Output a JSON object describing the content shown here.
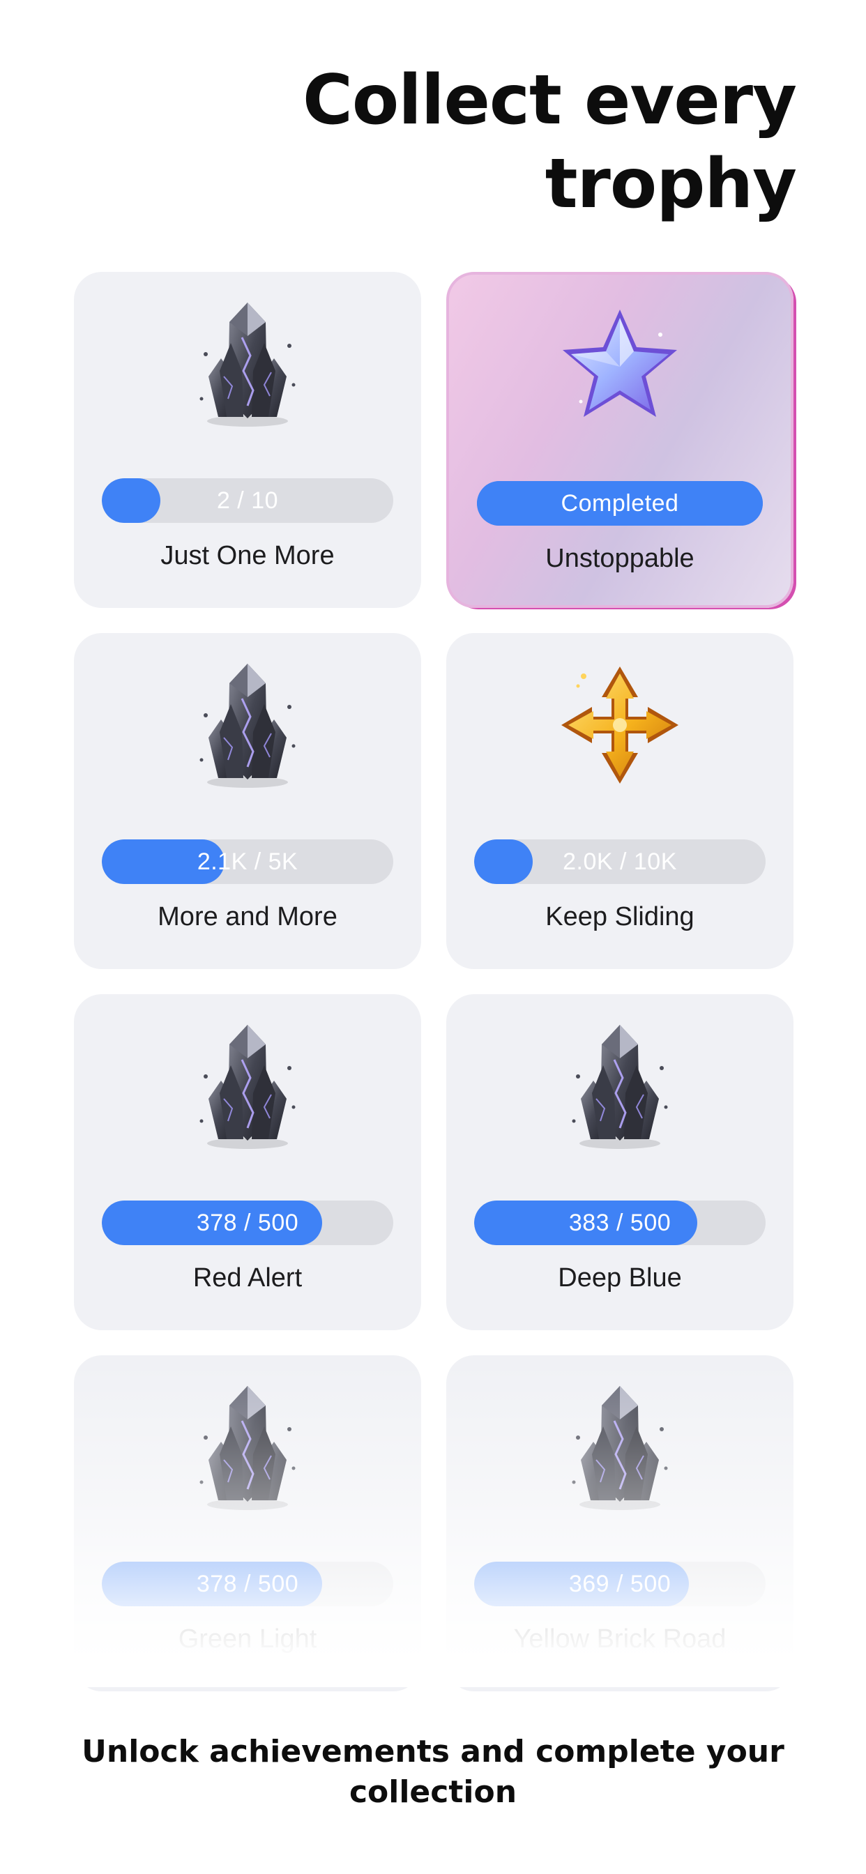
{
  "hero": {
    "title": "Collect every trophy"
  },
  "trophies": [
    {
      "name": "Just One More",
      "progress_text": "2 / 10",
      "progress": 0.2,
      "icon": "crystal-icon"
    },
    {
      "name": "Unstoppable",
      "progress_text": "Completed",
      "progress": 1.0,
      "icon": "star-icon",
      "completed": true
    },
    {
      "name": "More and More",
      "progress_text": "2.1K / 5K",
      "progress": 0.42,
      "icon": "crystal-icon"
    },
    {
      "name": "Keep Sliding",
      "progress_text": "2.0K / 10K",
      "progress": 0.2,
      "icon": "compass-arrows-icon"
    },
    {
      "name": "Red Alert",
      "progress_text": "378 / 500",
      "progress": 0.756,
      "icon": "crystal-icon"
    },
    {
      "name": "Deep Blue",
      "progress_text": "383 / 500",
      "progress": 0.766,
      "icon": "crystal-icon"
    },
    {
      "name": "Green Light",
      "progress_text": "378 / 500",
      "progress": 0.756,
      "icon": "crystal-icon"
    },
    {
      "name": "Yellow Brick Road",
      "progress_text": "369 / 500",
      "progress": 0.738,
      "icon": "crystal-icon"
    }
  ],
  "footer": {
    "subtitle": "Unlock achievements and complete your collection"
  },
  "colors": {
    "accent": "#3f82f6",
    "card_background": "#f0f1f5",
    "track": "#dcdde2"
  }
}
